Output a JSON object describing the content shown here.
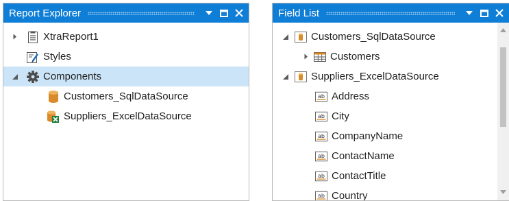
{
  "report_explorer": {
    "title": "Report Explorer",
    "items": [
      {
        "label": "XtraReport1",
        "icon": "report-icon",
        "expander": "collapsed"
      },
      {
        "label": "Styles",
        "icon": "styles-icon",
        "expander": "none"
      },
      {
        "label": "Components",
        "icon": "gear-icon",
        "expander": "expanded",
        "selected": true
      },
      {
        "label": "Customers_SqlDataSource",
        "icon": "sql-datasource-icon"
      },
      {
        "label": "Suppliers_ExcelDataSource",
        "icon": "excel-datasource-icon"
      }
    ]
  },
  "field_list": {
    "title": "Field List",
    "items": [
      {
        "label": "Customers_SqlDataSource",
        "icon": "datasource-icon",
        "expander": "expanded"
      },
      {
        "label": "Customers",
        "icon": "table-icon",
        "expander": "collapsed"
      },
      {
        "label": "Suppliers_ExcelDataSource",
        "icon": "datasource-icon",
        "expander": "expanded"
      },
      {
        "label": "Address",
        "icon": "string-field-icon"
      },
      {
        "label": "City",
        "icon": "string-field-icon"
      },
      {
        "label": "CompanyName",
        "icon": "string-field-icon"
      },
      {
        "label": "ContactName",
        "icon": "string-field-icon"
      },
      {
        "label": "ContactTitle",
        "icon": "string-field-icon"
      },
      {
        "label": "Country",
        "icon": "string-field-icon"
      }
    ]
  },
  "colors": {
    "titlebar": "#0f7ed6",
    "selection": "#cce4f7"
  }
}
